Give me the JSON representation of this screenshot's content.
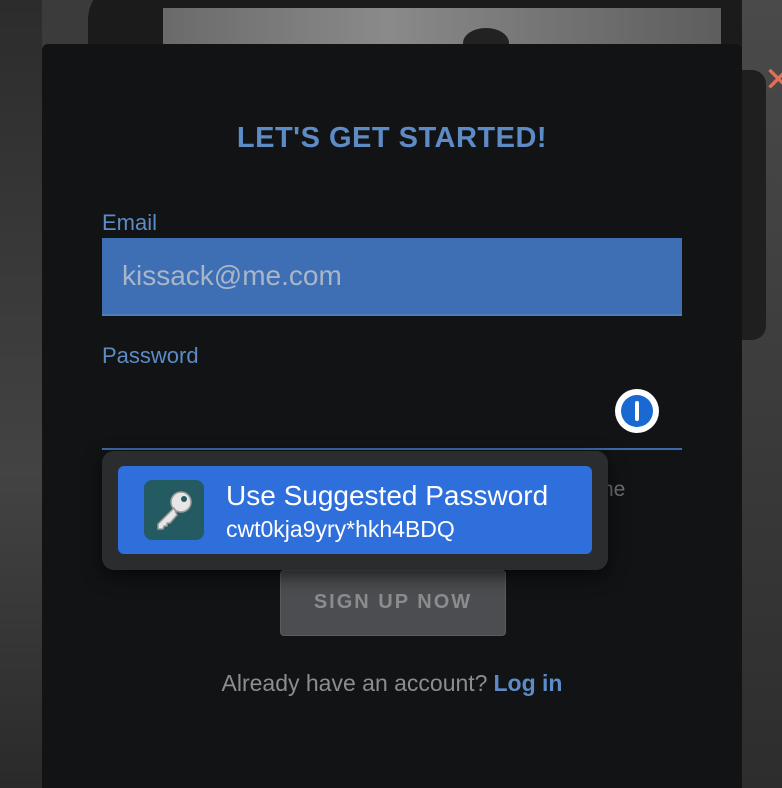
{
  "modal": {
    "title": "LET'S GET STARTED!",
    "email_label": "Email",
    "email_value": "kissack@me.com",
    "password_label": "Password",
    "password_value": "",
    "partial_text_behind_popup": "he",
    "signup_label": "SIGN UP NOW",
    "already_text": "Already have an account?",
    "login_label": "Log in"
  },
  "suggestion": {
    "title": "Use Suggested Password",
    "password": "cwt0kja9yry*hkh4BDQ"
  },
  "icons": {
    "close": "close-icon",
    "password_manager": "1password-icon",
    "key": "key-icon"
  },
  "colors": {
    "accent": "#5c8bc6",
    "email_field_bg": "#3e6fb4",
    "suggestion_bg": "#2f6fdb",
    "close": "#e0705a"
  }
}
